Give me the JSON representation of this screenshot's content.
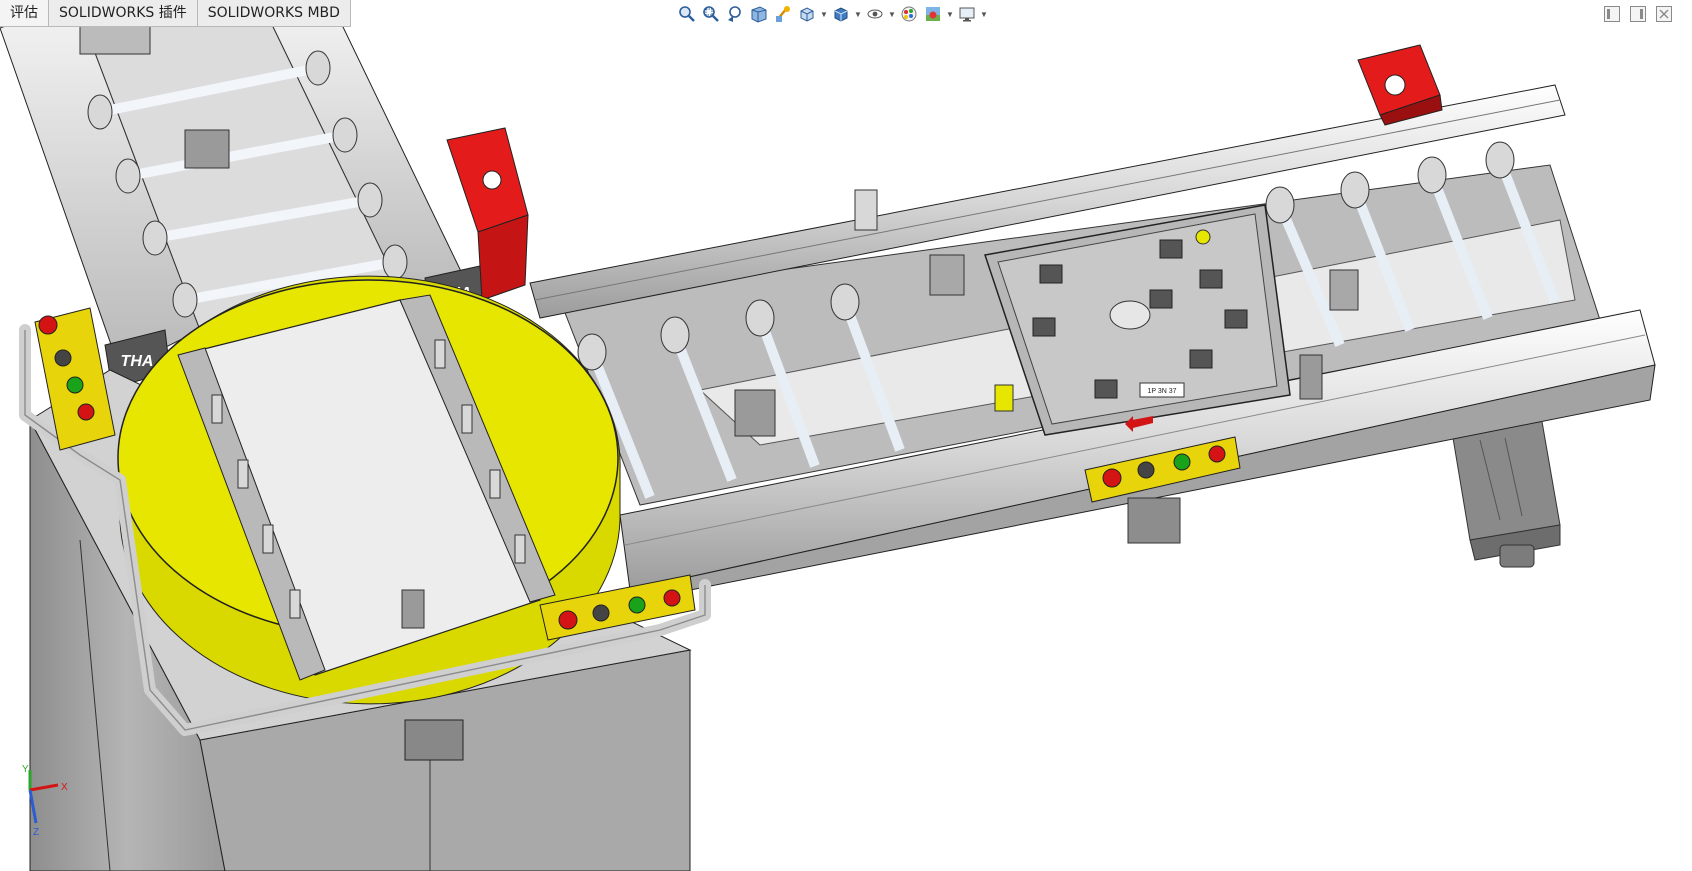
{
  "tabs": [
    {
      "label": "评估"
    },
    {
      "label": "SOLIDWORKS 插件"
    },
    {
      "label": "SOLIDWORKS MBD"
    }
  ],
  "heads_up_toolbar": [
    {
      "icon": "zoom-to-fit-icon"
    },
    {
      "icon": "zoom-to-area-icon"
    },
    {
      "icon": "previous-view-icon"
    },
    {
      "icon": "section-view-icon"
    },
    {
      "icon": "dynamic-annotation-icon"
    },
    {
      "icon": "view-orientation-icon",
      "dropdown": true
    },
    {
      "icon": "display-style-icon",
      "dropdown": true
    },
    {
      "icon": "hide-show-items-icon",
      "dropdown": true
    },
    {
      "icon": "edit-appearance-icon"
    },
    {
      "icon": "apply-scene-icon",
      "dropdown": true
    },
    {
      "icon": "view-settings-icon",
      "dropdown": true
    }
  ],
  "window_controls": [
    {
      "icon": "restore-left-icon"
    },
    {
      "icon": "restore-right-icon"
    },
    {
      "icon": "close-window-icon"
    }
  ],
  "model": {
    "brand_label": "THA",
    "pallet_label": "1P 3N 37",
    "colors": {
      "turntable": "#e6e600",
      "motor": "#e31b1b",
      "frame": "#c4c4c4",
      "panel": "#f0f0f0",
      "button_green": "#1aa31a",
      "button_red": "#d41414",
      "control_box": "#e8d40a"
    }
  },
  "triad": {
    "x_label": "X",
    "y_label": "Y",
    "z_label": "Z"
  }
}
